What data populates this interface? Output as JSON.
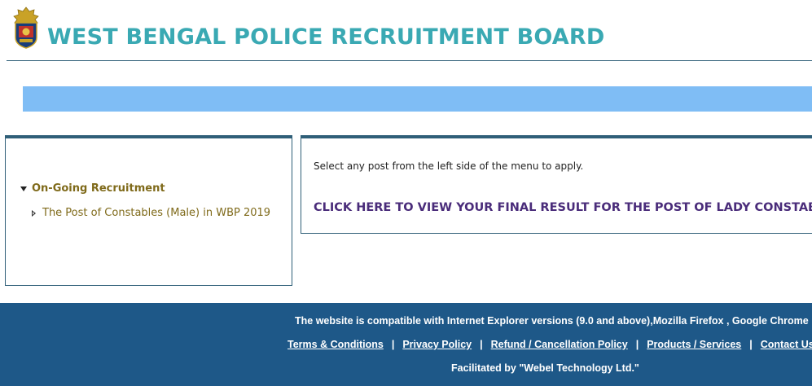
{
  "header": {
    "title": "WEST BENGAL POLICE RECRUITMENT BOARD",
    "logo_icon": "police-emblem-icon"
  },
  "sidebar": {
    "heading": "On-Going Recruitment",
    "items": [
      {
        "label": "The Post of Constables (Male) in WBP 2019"
      }
    ]
  },
  "main": {
    "instruction": "Select any post from the left side of the menu to apply.",
    "result_link": "CLICK HERE TO VIEW YOUR FINAL RESULT FOR THE POST OF LADY CONSTABLES IN W"
  },
  "footer": {
    "compatibility": "The website is compatible with Internet Explorer versions (9.0 and above),Mozilla Firefox , Google Chrome",
    "links": [
      {
        "label": "Terms & Conditions"
      },
      {
        "label": "Privacy Policy"
      },
      {
        "label": "Refund / Cancellation Policy"
      },
      {
        "label": "Products / Services"
      },
      {
        "label": "Contact Us"
      }
    ],
    "separator": "|",
    "facilitated": "Facilitated by \"Webel Technology Ltd.\""
  },
  "colors": {
    "title": "#3aa9b3",
    "banner": "#7fbdf5",
    "panel_border": "#2f5f78",
    "menu_text": "#7f6a1a",
    "link_text": "#4a2c7a",
    "footer_bg": "#1e5888"
  }
}
